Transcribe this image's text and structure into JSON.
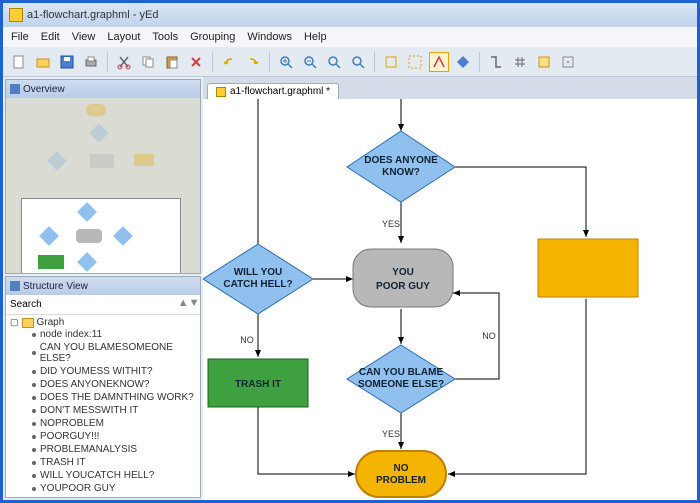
{
  "window": {
    "title": "a1-flowchart.graphml - yEd"
  },
  "menu": {
    "file": "File",
    "edit": "Edit",
    "view": "View",
    "layout": "Layout",
    "tools": "Tools",
    "grouping": "Grouping",
    "windows": "Windows",
    "help": "Help"
  },
  "panels": {
    "overview": "Overview",
    "structure": "Structure View",
    "search_label": "Search"
  },
  "tab": {
    "label": "a1-flowchart.graphml *"
  },
  "tree": {
    "root": "Graph",
    "items": [
      "node index:11",
      "CAN YOU BLAMESOMEONE ELSE?",
      "DID YOUMESS WITHIT?",
      "DOES ANYONEKNOW?",
      "DOES THE DAMNTHING WORK?",
      "DON'T MESSWITH IT",
      "NOPROBLEM",
      "POORGUY!!!",
      "PROBLEMANALYSIS",
      "TRASH IT",
      "WILL YOUCATCH HELL?",
      "YOUPOOR GUY"
    ]
  },
  "nodes": {
    "does_anyone_know": {
      "l1": "DOES ANYONE",
      "l2": "KNOW?"
    },
    "will_catch_hell": {
      "l1": "WILL YOU",
      "l2": "CATCH HELL?"
    },
    "you_poor_guy": {
      "l1": "YOU",
      "l2": "POOR GUY"
    },
    "can_you_blame": {
      "l1": "CAN YOU BLAME",
      "l2": "SOMEONE ELSE?"
    },
    "trash_it": "TRASH IT",
    "no_problem": {
      "l1": "NO",
      "l2": "PROBLEM"
    }
  },
  "edges": {
    "yes1": "YES",
    "yes2": "YES",
    "no1": "NO",
    "no2": "NO"
  },
  "colors": {
    "diamond_fill": "#8fc0ee",
    "diamond_stroke": "#2a6cb0",
    "process_fill": "#b8b8b8",
    "trash_fill": "#3fa040",
    "orange_fill": "#f5b400",
    "orange_stroke": "#c08000",
    "terminal_fill": "#f5b400"
  }
}
